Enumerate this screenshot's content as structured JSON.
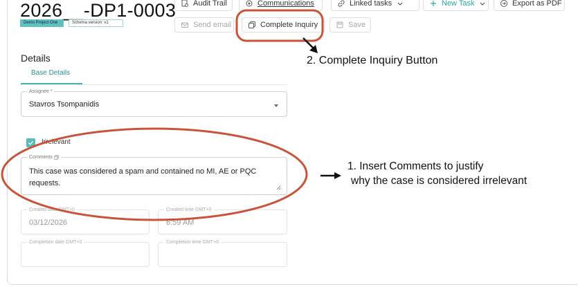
{
  "header": {
    "case_id": "2026__-DP1-0003",
    "project_badge": "Demo Project One",
    "schema_badge": "Schema version: v1"
  },
  "toolbar": {
    "audit_trail": "Audit Trail",
    "communications": "Communications",
    "linked_tasks": "Linked tasks",
    "new_task": "New Task",
    "export_pdf": "Export as PDF",
    "send_email": "Send email",
    "complete_inquiry": "Complete Inquiry",
    "save": "Save"
  },
  "details": {
    "title": "Details",
    "tab": "Base Details",
    "assignee": {
      "label": "Assignee *",
      "value": "Stavros Tsompanidis"
    },
    "irrelevant": {
      "label": "Irrelevant",
      "checked": true
    },
    "comments": {
      "label": "Comments",
      "value": "This case was considered a spam and contained no MI, AE or PQC requests."
    },
    "created_date": {
      "label": "Created date GMT+0",
      "value": "03/12/2026"
    },
    "created_time": {
      "label": "Created time GMT+0",
      "value": "6:59 AM"
    },
    "completion_date": {
      "label": "Completion date GMT+0",
      "value": ""
    },
    "completion_time": {
      "label": "Completion time GMT+0",
      "value": ""
    }
  },
  "annotations": {
    "step2": "2.  Complete Inquiry Button",
    "step1_line1": "1.   Insert Comments to justify",
    "step1_line2": "why the case is considered irrelevant",
    "highlight_color": "#c9533a"
  }
}
